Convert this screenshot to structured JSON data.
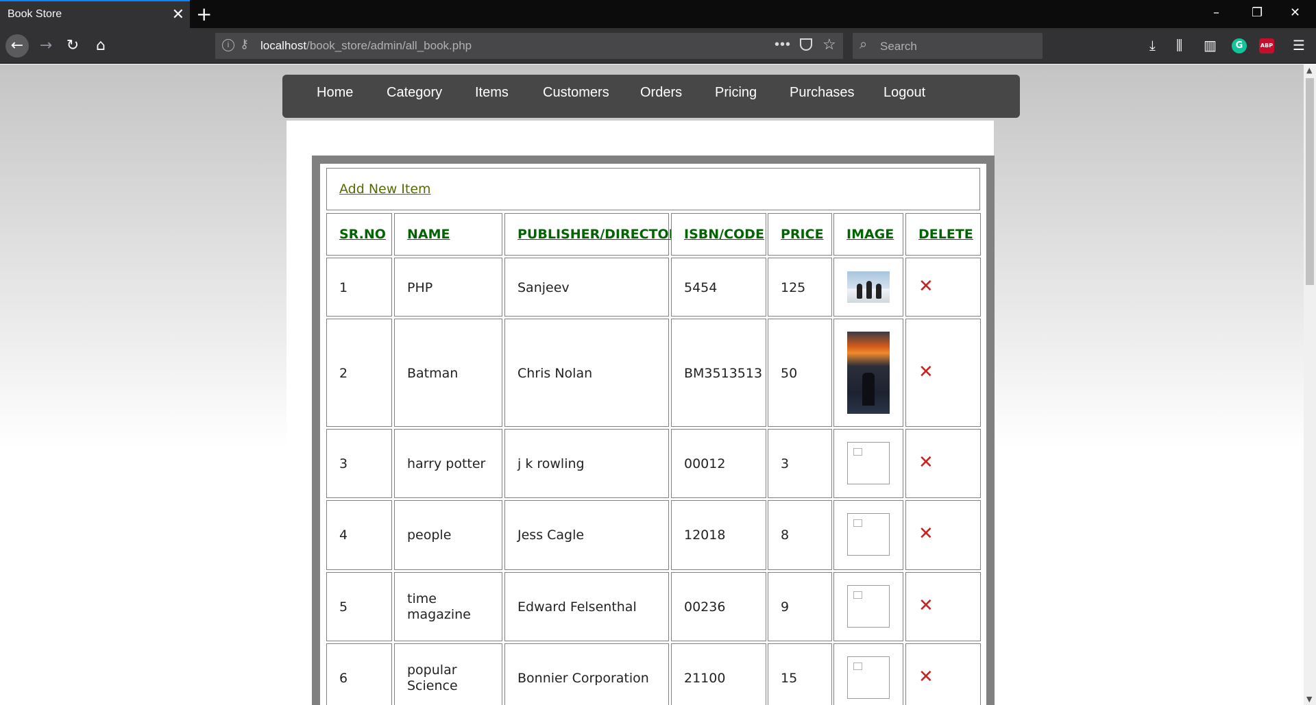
{
  "browser": {
    "tab_title": "Book Store",
    "url_host": "localhost",
    "url_path": "/book_store/admin/all_book.php",
    "search_placeholder": "Search",
    "grammarly_label": "G",
    "abp_label": "ABP"
  },
  "menu": {
    "items": [
      {
        "label": "Home"
      },
      {
        "label": "Category"
      },
      {
        "label": "Items"
      },
      {
        "label": "Customers"
      },
      {
        "label": "Orders"
      },
      {
        "label": "Pricing"
      },
      {
        "label": "Purchases"
      },
      {
        "label": "Logout"
      }
    ]
  },
  "table": {
    "add_link": "Add New Item",
    "headers": [
      "SR.NO",
      "NAME",
      "PUBLISHER/DIRECTOR",
      "ISBN/CODE",
      "PRICE",
      "IMAGE",
      "DELETE"
    ],
    "rows": [
      {
        "sr": "1",
        "name": "PHP",
        "publisher": "Sanjeev",
        "isbn": "5454",
        "price": "125",
        "image": "penguins-thumbnail",
        "delete": "✕"
      },
      {
        "sr": "2",
        "name": "Batman",
        "publisher": "Chris Nolan",
        "isbn": "BM3513513",
        "price": "50",
        "image": "batman-poster-thumbnail",
        "delete": "✕"
      },
      {
        "sr": "3",
        "name": "harry potter",
        "publisher": "j k rowling",
        "isbn": "00012",
        "price": "3",
        "image": "broken-image",
        "delete": "✕"
      },
      {
        "sr": "4",
        "name": "people",
        "publisher": "Jess Cagle",
        "isbn": "12018",
        "price": "8",
        "image": "broken-image",
        "delete": "✕"
      },
      {
        "sr": "5",
        "name": "time magazine",
        "publisher": "Edward Felsenthal",
        "isbn": "00236",
        "price": "9",
        "image": "broken-image",
        "delete": "✕"
      },
      {
        "sr": "6",
        "name": "popular Science",
        "publisher": "Bonnier Corporation",
        "isbn": "21100",
        "price": "15",
        "image": "broken-image",
        "delete": "✕"
      }
    ]
  },
  "colors": {
    "menu_bg": "#474747",
    "header_link": "#006400",
    "add_link": "#556b00",
    "delete": "#cc1f1f",
    "frame": "#808080"
  }
}
